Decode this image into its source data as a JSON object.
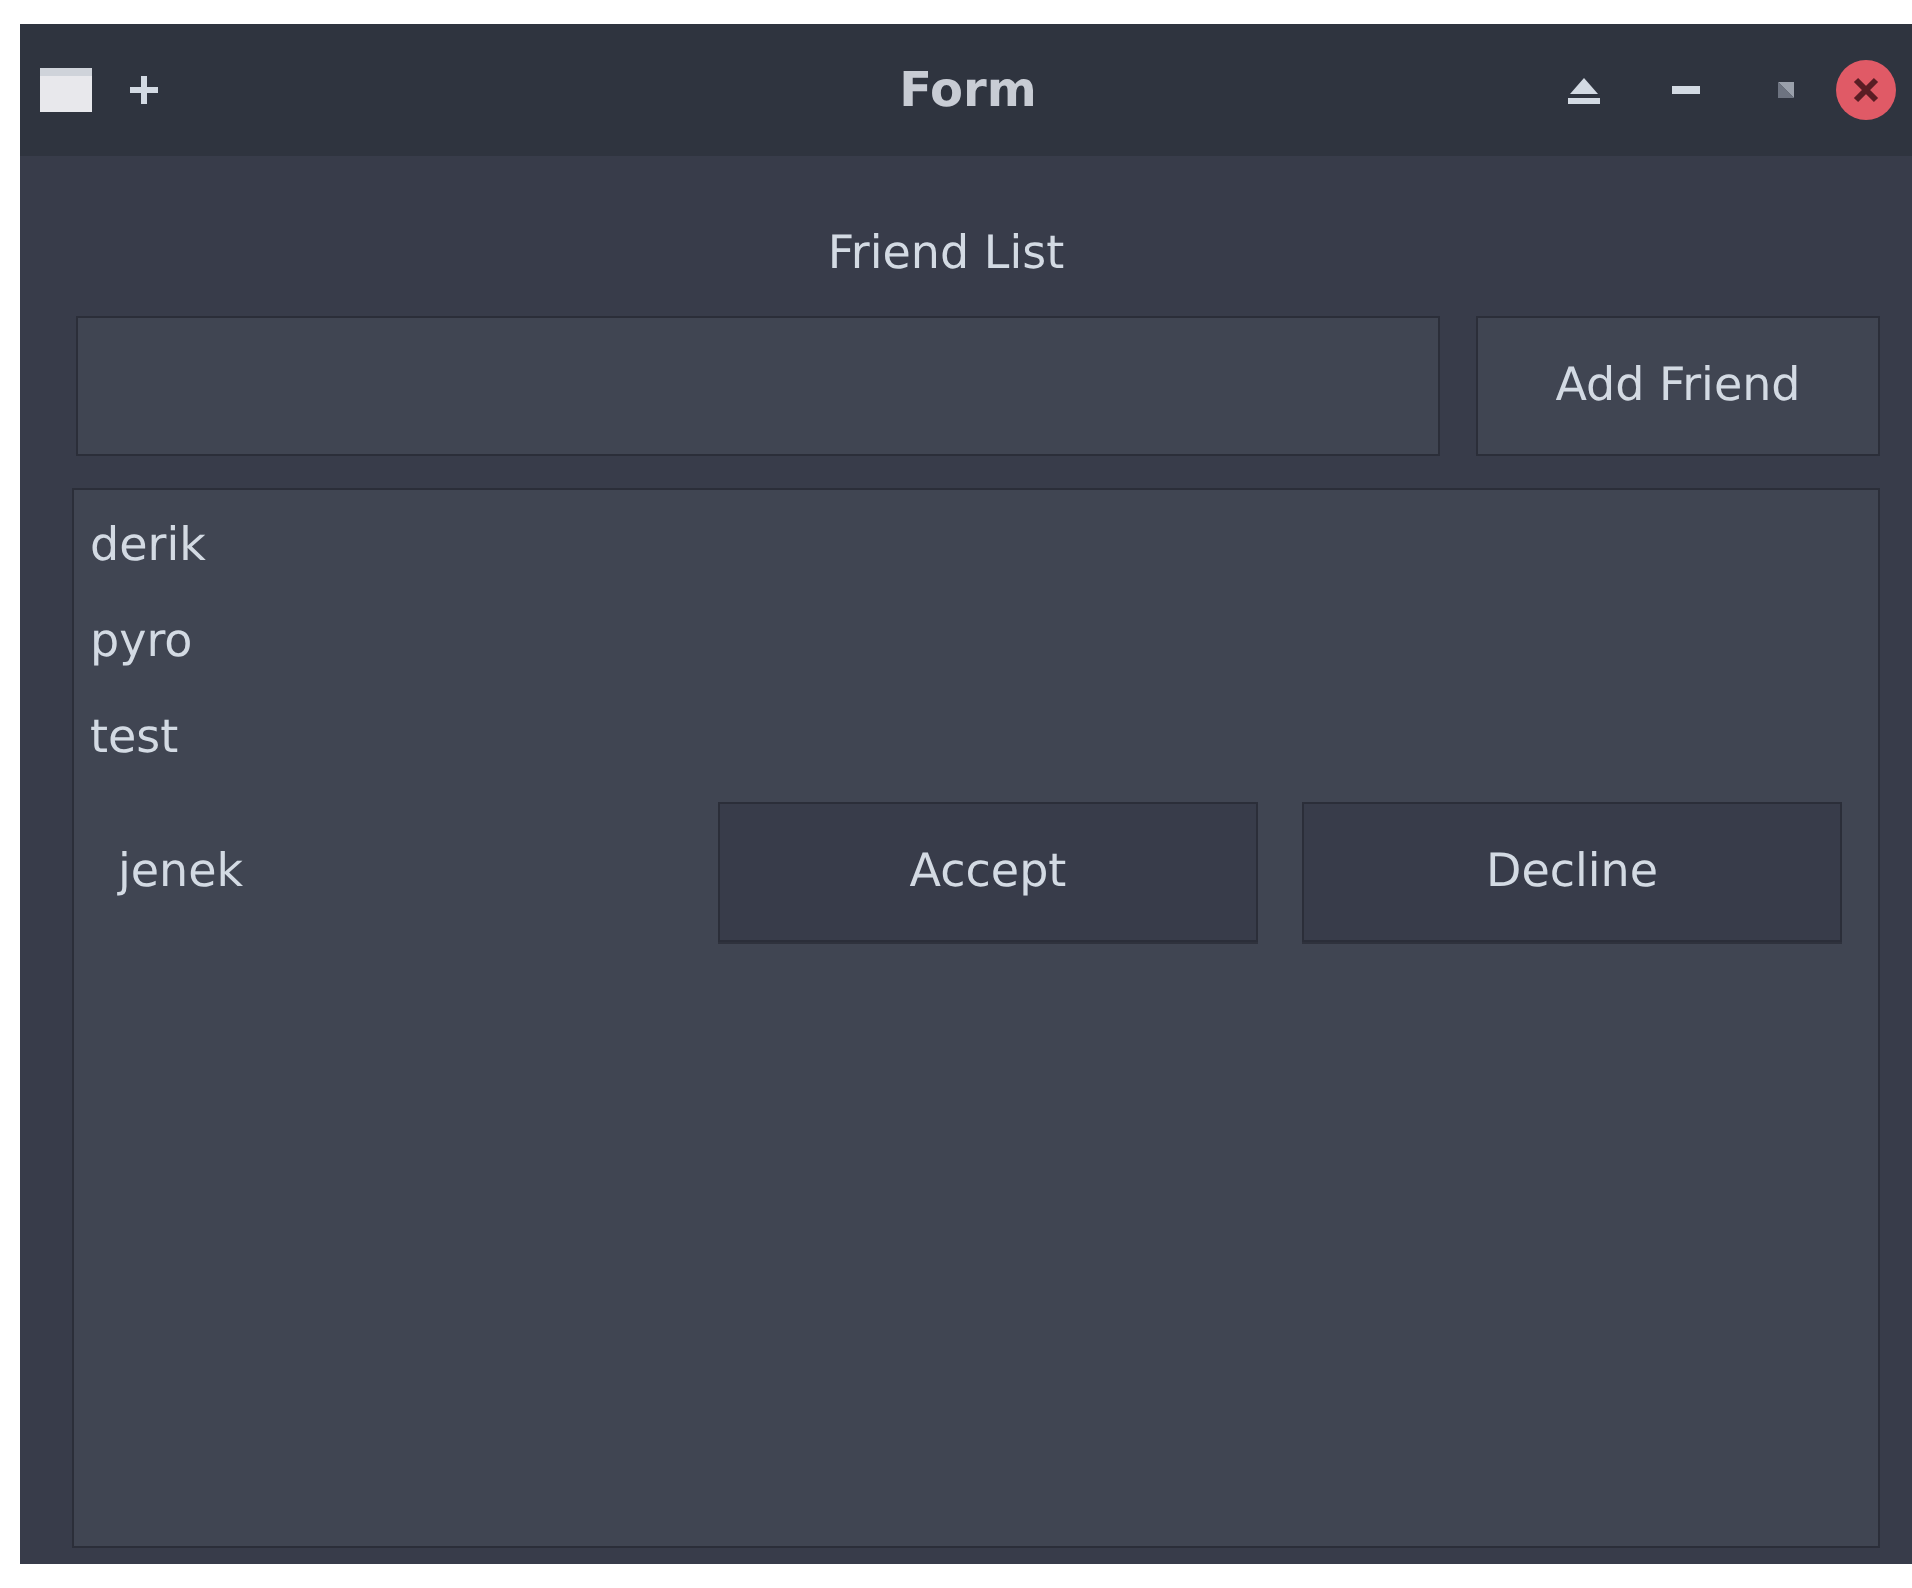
{
  "window": {
    "title": "Form"
  },
  "heading": "Friend List",
  "add_button": "Add Friend",
  "friends": [
    "derik",
    "pyro",
    "test"
  ],
  "requests": [
    {
      "name": "jenek",
      "accept": "Accept",
      "decline": "Decline"
    }
  ]
}
